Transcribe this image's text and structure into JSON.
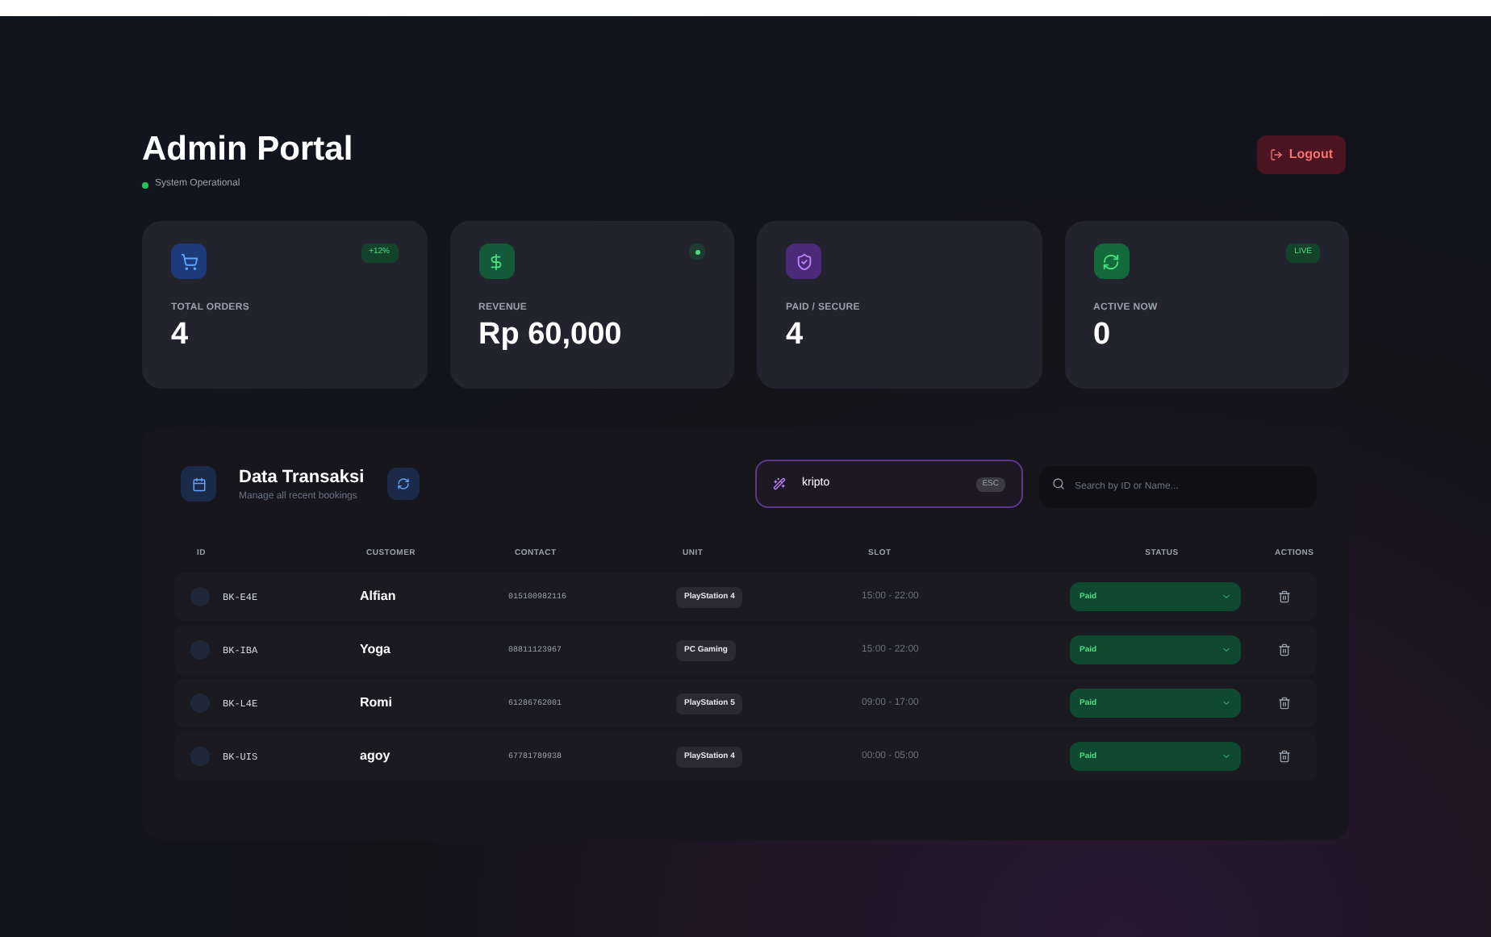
{
  "header": {
    "title": "Admin Portal",
    "status": "System Operational",
    "logout": "Logout"
  },
  "stats": [
    {
      "kind": "orders",
      "label": "TOTAL ORDERS",
      "value": "4",
      "badge": "+12%"
    },
    {
      "kind": "revenue",
      "label": "REVENUE",
      "value": "Rp 60,000",
      "indicator": true
    },
    {
      "kind": "paid",
      "label": "PAID / SECURE",
      "value": "4"
    },
    {
      "kind": "active",
      "label": "ACTIVE NOW",
      "value": "0",
      "badge": "LIVE"
    }
  ],
  "panel": {
    "title": "Data Transaksi",
    "subtitle": "Manage all recent bookings",
    "filter": {
      "value": "kripto",
      "key": "ESC"
    },
    "search": {
      "placeholder": "Search by ID or Name..."
    }
  },
  "table": {
    "columns": [
      "ID",
      "CUSTOMER",
      "CONTACT",
      "UNIT",
      "SLOT",
      "STATUS",
      "ACTIONS"
    ],
    "rows": [
      {
        "id": "BK-E4E",
        "customer": "Alfian",
        "contact": "015100982116",
        "unit": "PlayStation 4",
        "slot": "15:00 - 22:00",
        "status": "Paid"
      },
      {
        "id": "BK-IBA",
        "customer": "Yoga",
        "contact": "08811123967",
        "unit": "PC Gaming",
        "slot": "15:00 - 22:00",
        "status": "Paid"
      },
      {
        "id": "BK-L4E",
        "customer": "Romi",
        "contact": "61286762001",
        "unit": "PlayStation 5",
        "slot": "09:00 - 17:00",
        "status": "Paid"
      },
      {
        "id": "BK-UIS",
        "customer": "agoy",
        "contact": "67781789938",
        "unit": "PlayStation 4",
        "slot": "00:00 - 05:00",
        "status": "Paid"
      }
    ]
  }
}
